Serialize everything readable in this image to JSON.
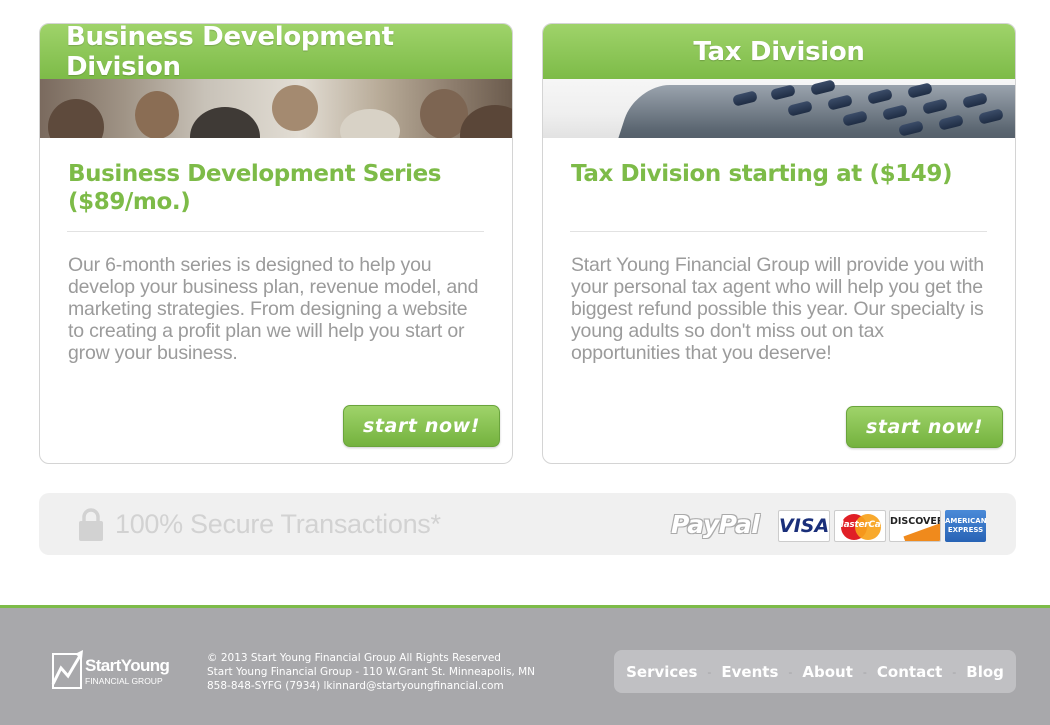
{
  "cards": [
    {
      "header": "Business Development Division",
      "title": "Business Development Series ($89/mo.)",
      "description": "Our 6-month series is designed to help you develop your business plan, revenue model, and marketing strategies. From designing a website to creating a profit plan we will help you start or grow your business.",
      "button_label": "start now!",
      "photo": "classroom-photo"
    },
    {
      "header": "Tax Division",
      "title": "Tax Division starting at ($149)",
      "description": "Start Young Financial Group will provide you with your personal tax agent who will help you get the biggest refund possible this year. Our specialty is young adults so don't miss out on tax opportunities that you deserve!",
      "button_label": "start now!",
      "photo": "calculator-photo"
    }
  ],
  "secure": {
    "text": "100% Secure Transactions*",
    "icon": "lock-icon",
    "payment_logos": {
      "paypal": "PayPal",
      "visa": "VISA",
      "mastercard": "MasterCard",
      "discover": "DISCOVER",
      "amex_line1": "AMERICAN",
      "amex_line2": "EXPRESS"
    }
  },
  "footer": {
    "logo_name": "StartYoung",
    "logo_sub": "FINANCIAL GROUP",
    "copyright": "© 2013 Start Young Financial Group All Rights Reserved",
    "address": "Start Young Financial Group - 110 W.Grant St. Minneapolis, MN",
    "contact": "858-848-SYFG (7934) lkinnard@startyoungfinancial.com",
    "nav": [
      "Services",
      "Events",
      "About",
      "Contact",
      "Blog"
    ]
  },
  "colors": {
    "accent_green": "#7dbb48",
    "footer_gray": "#a8a8ab",
    "body_text_gray": "#9b9b9b"
  }
}
